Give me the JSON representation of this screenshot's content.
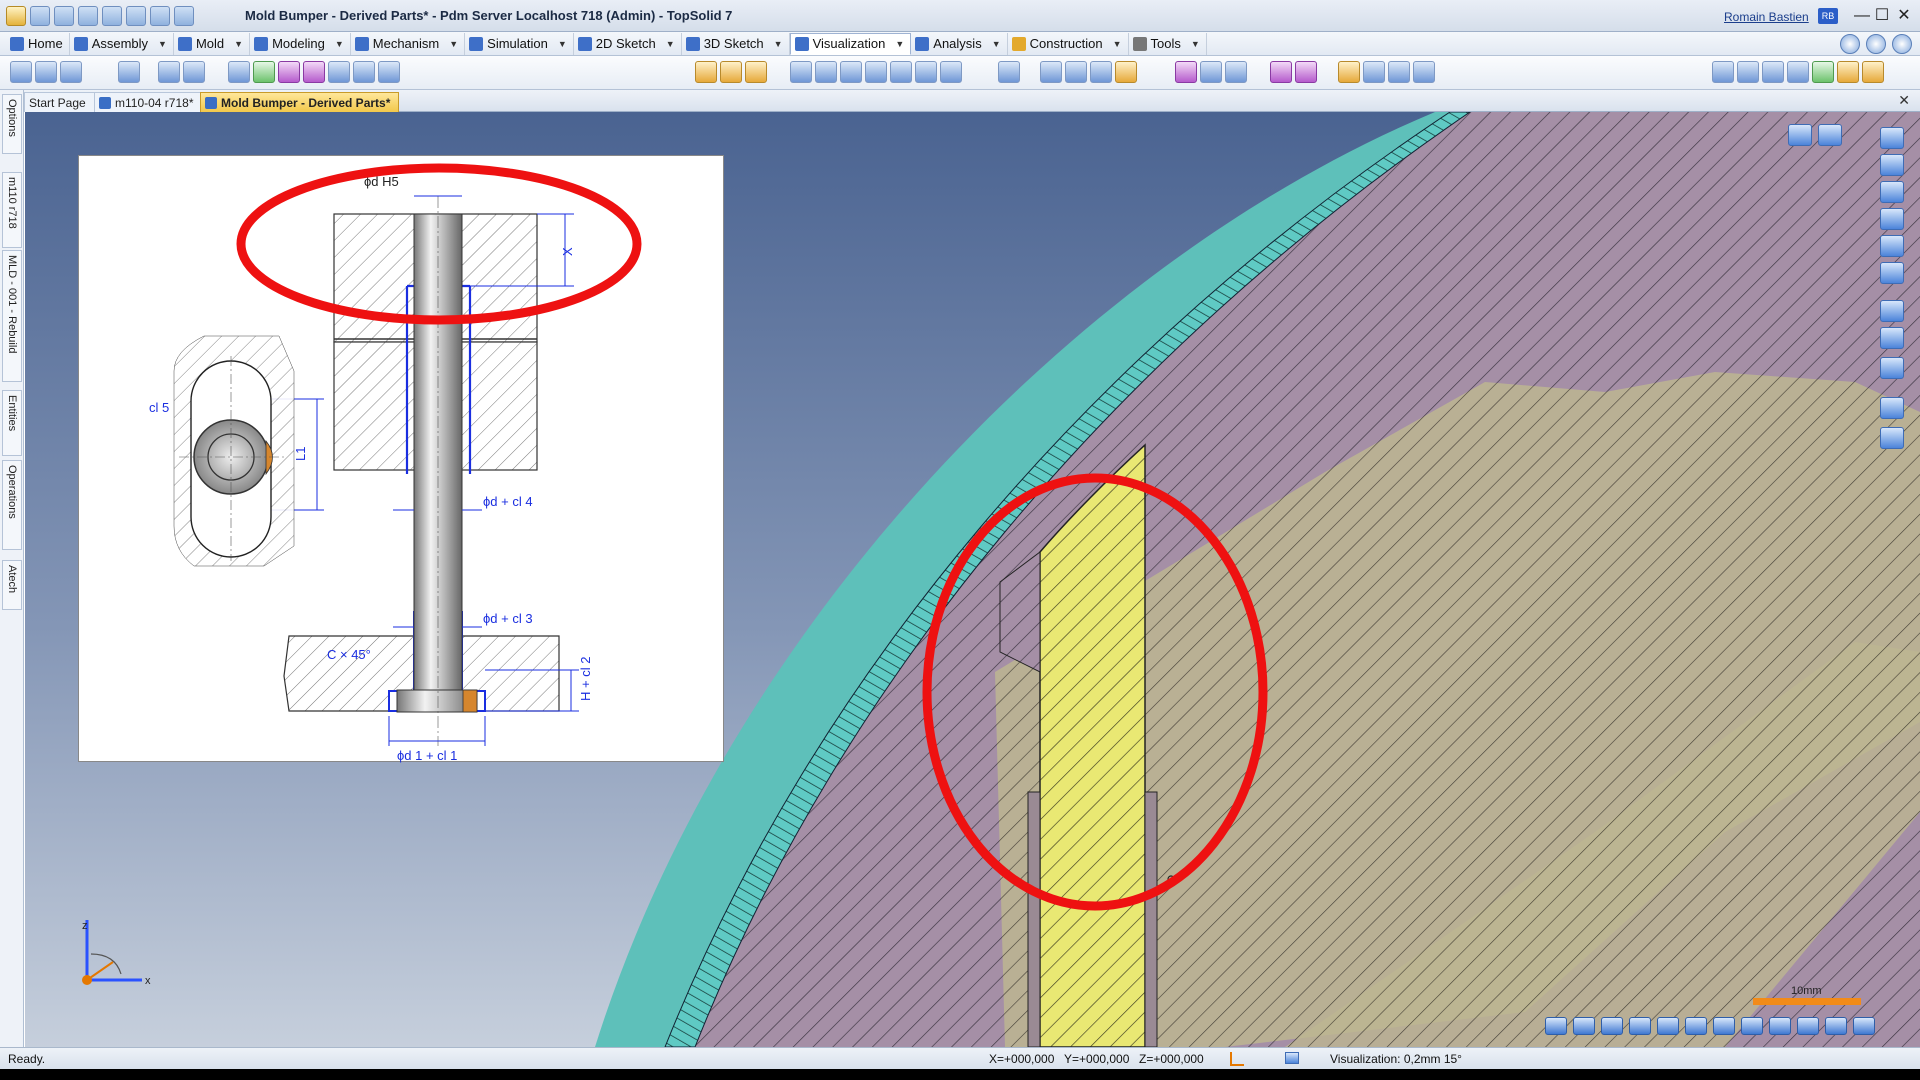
{
  "window": {
    "title": "Mold Bumper - Derived Parts* - Pdm Server Localhost 718 (Admin) - TopSolid 7",
    "user": "Romain Bastien",
    "user_initials": "RB",
    "minimize": "—",
    "maximize": "☐",
    "close": "✕"
  },
  "menu": {
    "tabs": [
      {
        "label": "Home"
      },
      {
        "label": "Assembly"
      },
      {
        "label": "Mold"
      },
      {
        "label": "Modeling"
      },
      {
        "label": "Mechanism"
      },
      {
        "label": "Simulation"
      },
      {
        "label": "2D Sketch"
      },
      {
        "label": "3D Sketch"
      },
      {
        "label": "Visualization"
      },
      {
        "label": "Analysis"
      },
      {
        "label": "Construction"
      },
      {
        "label": "Tools"
      }
    ],
    "active": "Visualization",
    "dropdown_glyph": "▼"
  },
  "documents": {
    "tabs": [
      {
        "label": "Start Page"
      },
      {
        "label": "m110-04 r718*"
      },
      {
        "label": "Mold Bumper - Derived Parts*"
      }
    ],
    "active": "Mold Bumper - Derived Parts*",
    "close_glyph": "✕"
  },
  "side_tabs": [
    {
      "label": "Options"
    },
    {
      "label": "m110 r718"
    },
    {
      "label": "MLD - 001 - Rebuild"
    },
    {
      "label": "Entities"
    },
    {
      "label": "Operations"
    },
    {
      "label": "Atech"
    }
  ],
  "drawing": {
    "labels": {
      "dia_h5": "ϕd H5",
      "x": "X",
      "cl5": "cl 5",
      "l1": "L1",
      "d_cl4": "ϕd + cl 4",
      "d_cl3": "ϕd + cl 3",
      "chamfer": "C × 45°",
      "h_cl2": "H + cl 2",
      "d1_cl1": "ϕd 1 + cl 1"
    }
  },
  "triad": {
    "z": "z",
    "x": "x"
  },
  "scale_bar": {
    "label": "10mm"
  },
  "status": {
    "left": "Ready.",
    "x": "X=+000,000",
    "y": "Y=+000,000",
    "z": "Z=+000,000",
    "visualization": "Visualization: 0,2mm 15°"
  },
  "colors": {
    "viewport_top": "#4a6391",
    "viewport_bottom": "#c6cfdc",
    "shell_teal": "#5ec0ba",
    "insert_yellow": "#e9e873",
    "mold_purple": "#a58fa6",
    "annotation_red": "#ee1111",
    "drawing_blue": "#1a2ee0"
  }
}
